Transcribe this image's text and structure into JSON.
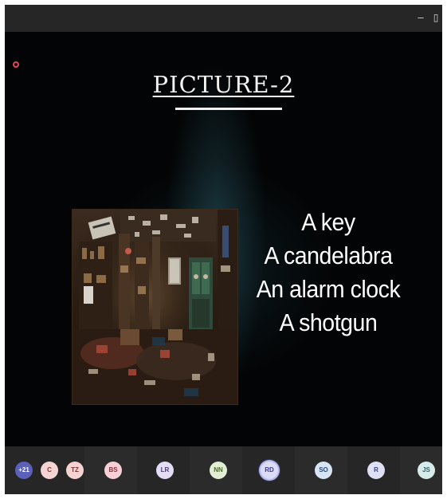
{
  "window": {
    "minimize_glyph": "–",
    "restore_glyph": "▯"
  },
  "slide": {
    "title": "PICTURE-2",
    "items": [
      "A key",
      "A candelabra",
      "An alarm clock",
      "A shotgun"
    ]
  },
  "participants": [
    {
      "initials": "+21",
      "bg": "#5b60b8",
      "fg": "#ffffff"
    },
    {
      "initials": "C",
      "bg": "#f6d4d4",
      "fg": "#8a2f2f"
    },
    {
      "initials": "TZ",
      "bg": "#f7d2d2",
      "fg": "#8a2f2f"
    },
    {
      "initials": "BS",
      "bg": "#f8cfd6",
      "fg": "#8a2f3d"
    },
    {
      "initials": "LR",
      "bg": "#e3dcf4",
      "fg": "#4a3b7a"
    },
    {
      "initials": "NN",
      "bg": "#e2efd4",
      "fg": "#4a6a2a"
    },
    {
      "initials": "RD",
      "bg": "#dcdcf6",
      "fg": "#3c3c8a"
    },
    {
      "initials": "SO",
      "bg": "#d7e4f4",
      "fg": "#2e4a78"
    },
    {
      "initials": "R",
      "bg": "#dde0f6",
      "fg": "#3a3f8a"
    },
    {
      "initials": "JS",
      "bg": "#d6ecec",
      "fg": "#2e6262"
    }
  ]
}
